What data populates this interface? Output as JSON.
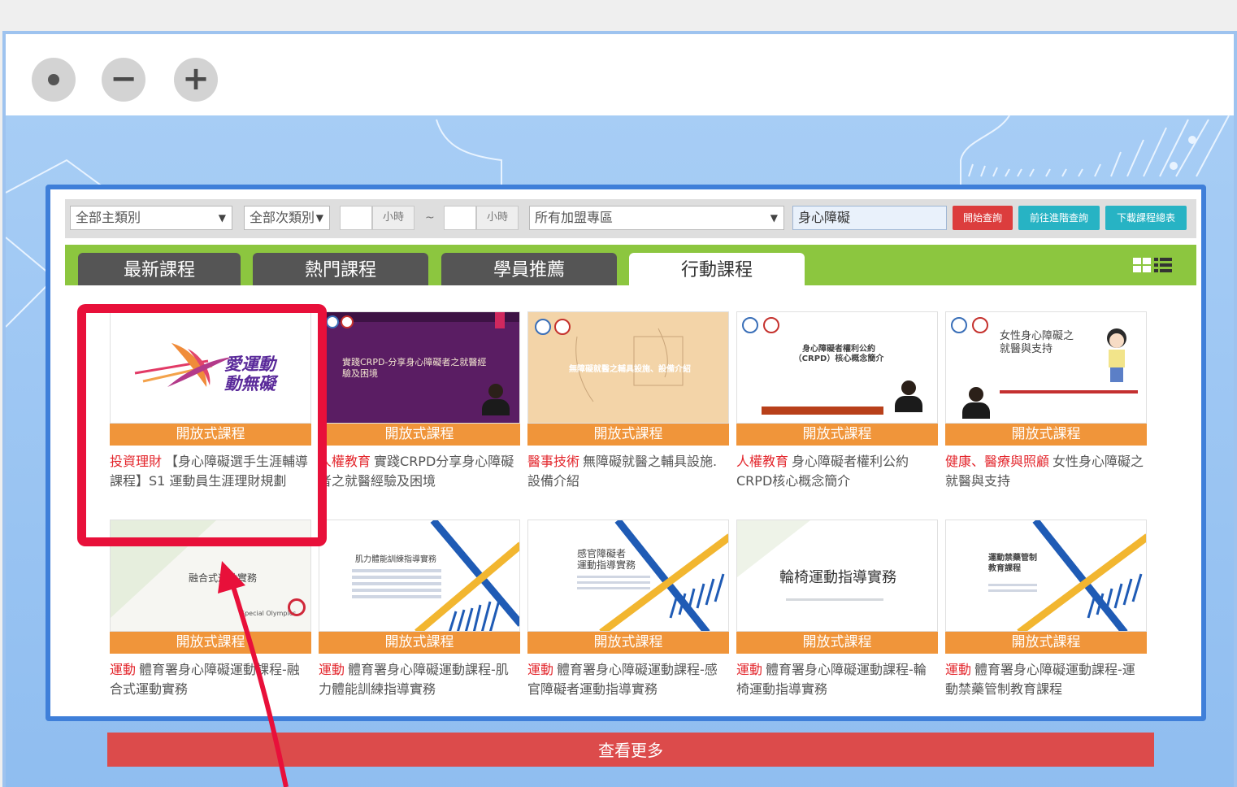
{
  "filters": {
    "main_category": "全部主類別",
    "sub_category": "全部次類別",
    "hours_from_unit": "小時",
    "tilde": "~",
    "hours_to_unit": "小時",
    "zone": "所有加盟專區",
    "search_value": "身心障礙",
    "btn_search": "開始查詢",
    "btn_advanced": "前往進階查詢",
    "btn_download": "下載課程總表"
  },
  "tabs": [
    {
      "label": "最新課程"
    },
    {
      "label": "熱門課程"
    },
    {
      "label": "學員推薦"
    },
    {
      "label": "行動課程"
    }
  ],
  "badge_label": "開放式課程",
  "thumbnails": {
    "t1_line1": "愛運動",
    "t1_line2": "動無礙",
    "t2_text": "實踐CRPD-分享身心障礙者之就醫經驗及困境",
    "t3_text": "無障礙就醫之輔具設施、設備介紹",
    "t4_text": "身心障礙者權利公約（CRPD）核心概念簡介",
    "t5_line1": "女性身心障礙之",
    "t5_line2": "就醫與支持",
    "t6_text": "融合式運動實務",
    "t6_brand": "Special Olympics",
    "t7_text": "肌力體能訓練指導實務",
    "t8_line1": "感官障礙者",
    "t8_line2": "運動指導實務",
    "t9_text": "輪椅運動指導實務",
    "t10_line1": "運動禁藥管制",
    "t10_line2": "教育課程"
  },
  "cards": [
    {
      "category": "投資理財",
      "title": "【身心障礙選手生涯輔導課程】S1 運動員生涯理財規劃"
    },
    {
      "category": "人權教育",
      "title": "實踐CRPD分享身心障礙者之就醫經驗及困境"
    },
    {
      "category": "醫事技術",
      "title": "無障礙就醫之輔具設施.設備介紹"
    },
    {
      "category": "人權教育",
      "title": "身心障礙者權利公約CRPD核心概念簡介"
    },
    {
      "category": "健康、醫療與照顧",
      "title": "女性身心障礙之就醫與支持"
    },
    {
      "category": "運動",
      "title": "體育署身心障礙運動課程-融合式運動實務"
    },
    {
      "category": "運動",
      "title": "體育署身心障礙運動課程-肌力體能訓練指導實務"
    },
    {
      "category": "運動",
      "title": "體育署身心障礙運動課程-感官障礙者運動指導實務"
    },
    {
      "category": "運動",
      "title": "體育署身心障礙運動課程-輪椅運動指導實務"
    },
    {
      "category": "運動",
      "title": "體育署身心障礙運動課程-運動禁藥管制教育課程"
    }
  ],
  "more_label": "查看更多",
  "colors": {
    "tab_band": "#8cc63f",
    "badge": "#f0953a",
    "category_text": "#e3262c",
    "highlight": "#e8103a",
    "more_button": "#dc4b4b"
  },
  "icons": [
    "window-close-icon",
    "window-minimize-icon",
    "window-maximize-icon",
    "grid-view-icon",
    "list-view-icon",
    "chevron-down-icon",
    "annotation-arrow-icon"
  ]
}
